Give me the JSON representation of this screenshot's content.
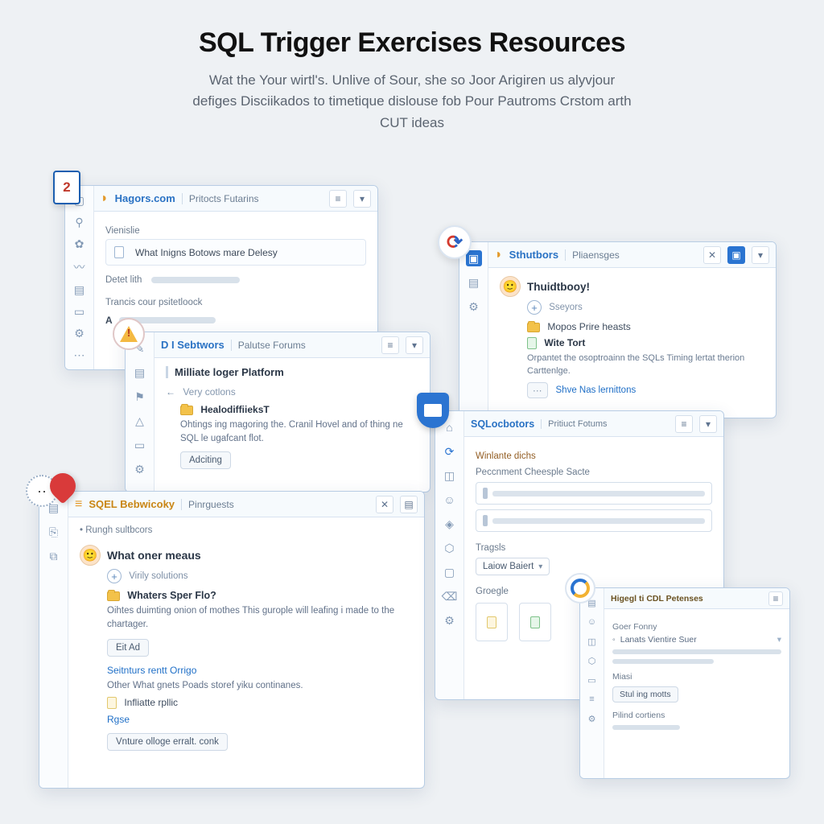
{
  "hero": {
    "title": "SQL Trigger Exercises Resources",
    "subtitle": "Wat the Your wirtl's. Unlive of Sour, she so Joor Arigiren us alyvjour defiges Disciikados to timetique dislouse fob Pour Pautroms Crstom arth CUT ideas"
  },
  "win_hagors": {
    "brand": "Hagors.com",
    "tab": "Pritocts Futarins",
    "section_top": "Vienislie",
    "card1": "What Inigns Botows mare Delesy",
    "label_detel": "Detet lith",
    "label_trans": "Trancis cour psitetloock"
  },
  "win_disebtwors": {
    "brand": "D I Sebtwors",
    "tab": "Palutse Forums",
    "heading": "Milliate loger Platform",
    "back": "Very cotlons",
    "file": "HealodiffiieksT",
    "desc": "Ohtings ing magoring the. Cranil Hovel and of thing ne SQL le ugafcant flot.",
    "btn": "Adciting"
  },
  "win_sqel": {
    "brand": "SQEL Bebwicoky",
    "tab": "Pinrguests",
    "rungh": "Rungh sultbcors",
    "h1": "What oner meaus",
    "sub": "Virily solutions",
    "file1": "Whaters Sper Flo?",
    "desc1": "Oihtes duimting onion of mothes This gurople will leafing i made to the chartager.",
    "btn1": "Eit Ad",
    "link1": "Seitnturs rentt Orrigo",
    "line2": "Other What gnets Poads storef yiku continanes.",
    "file2": "Infliatte rpllic",
    "link2": "Rgse",
    "btn2": "Vnture olloge erralt. conk"
  },
  "win_sthutbors": {
    "brand": "Sthutbors",
    "tab": "Pliaensges",
    "user": "Thuidtbooy!",
    "sub": "Sseyors",
    "file1": "Mopos Prire heasts",
    "file2": "Wite Tort",
    "desc": "Orpantet the osoptroainn the SQLs Timing lertat therion Carttenlge.",
    "link": "Shve Nas lernittons"
  },
  "win_sqlocbotors": {
    "brand": "SQLocbotors",
    "tab": "Pritiuct Fotums",
    "section1": "Winlante dichs",
    "section2": "Peccnment Cheesple Sacte",
    "section3": "Tragsls",
    "dropdown": "Laiow Baiert",
    "section4": "Groegle"
  },
  "win_mini": {
    "brand": "Higegl ti CDL Petenses",
    "section1": "Goer Fonny",
    "row1": "Lanats Vientire Suer",
    "section2": "Miasi",
    "btn": "Stul ing motts",
    "section3": "Pilind cortiens"
  },
  "badges": {
    "two": "2"
  }
}
